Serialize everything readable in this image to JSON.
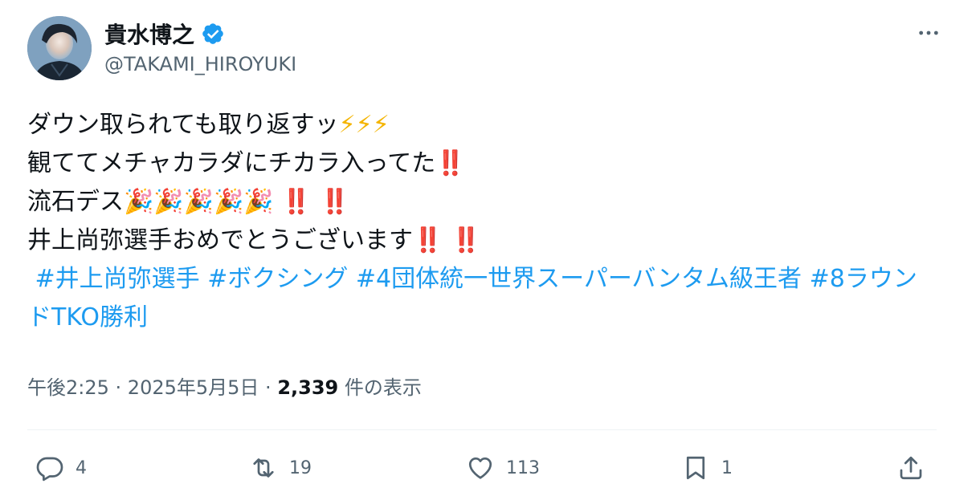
{
  "user": {
    "display_name": "貴水博之",
    "handle": "@TAKAMI_HIROYUKI",
    "verified_icon": "verified-badge-icon",
    "brand_color": "#1d9bf0"
  },
  "tweet": {
    "line1": "ダウン取られても取り返すッ",
    "line1_emoji": "⚡⚡⚡",
    "line2": "観ててメチャカラダにチカラ入ってた",
    "line2_emoji": "‼️",
    "line3": "流石デス",
    "line3_emoji": "🎉🎉🎉🎉🎉",
    "line3_bang": "‼️ ‼️",
    "line4": "井上尚弥選手おめでとうございます",
    "line4_bang": "‼️ ‼️",
    "hashtags": [
      "#井上尚弥選手",
      "#ボクシング",
      "#4団体統一世界スーパーバンタム級王者",
      "#8ラウンドTKO勝利"
    ]
  },
  "meta": {
    "time": "午後2:25",
    "sep1": " · ",
    "date": "2025年5月5日",
    "sep2": " · ",
    "views": "2,339",
    "views_label": " 件の表示"
  },
  "actions": {
    "reply": {
      "icon": "reply-icon",
      "count": "4"
    },
    "retweet": {
      "icon": "retweet-icon",
      "count": "19"
    },
    "like": {
      "icon": "heart-icon",
      "count": "113"
    },
    "bookmark": {
      "icon": "bookmark-icon",
      "count": "1"
    },
    "share": {
      "icon": "share-icon"
    }
  },
  "colors": {
    "text": "#0f1419",
    "secondary": "#536471",
    "link": "#1d9bf0",
    "lightning": "#f4b400",
    "bang": "#d0021b"
  }
}
